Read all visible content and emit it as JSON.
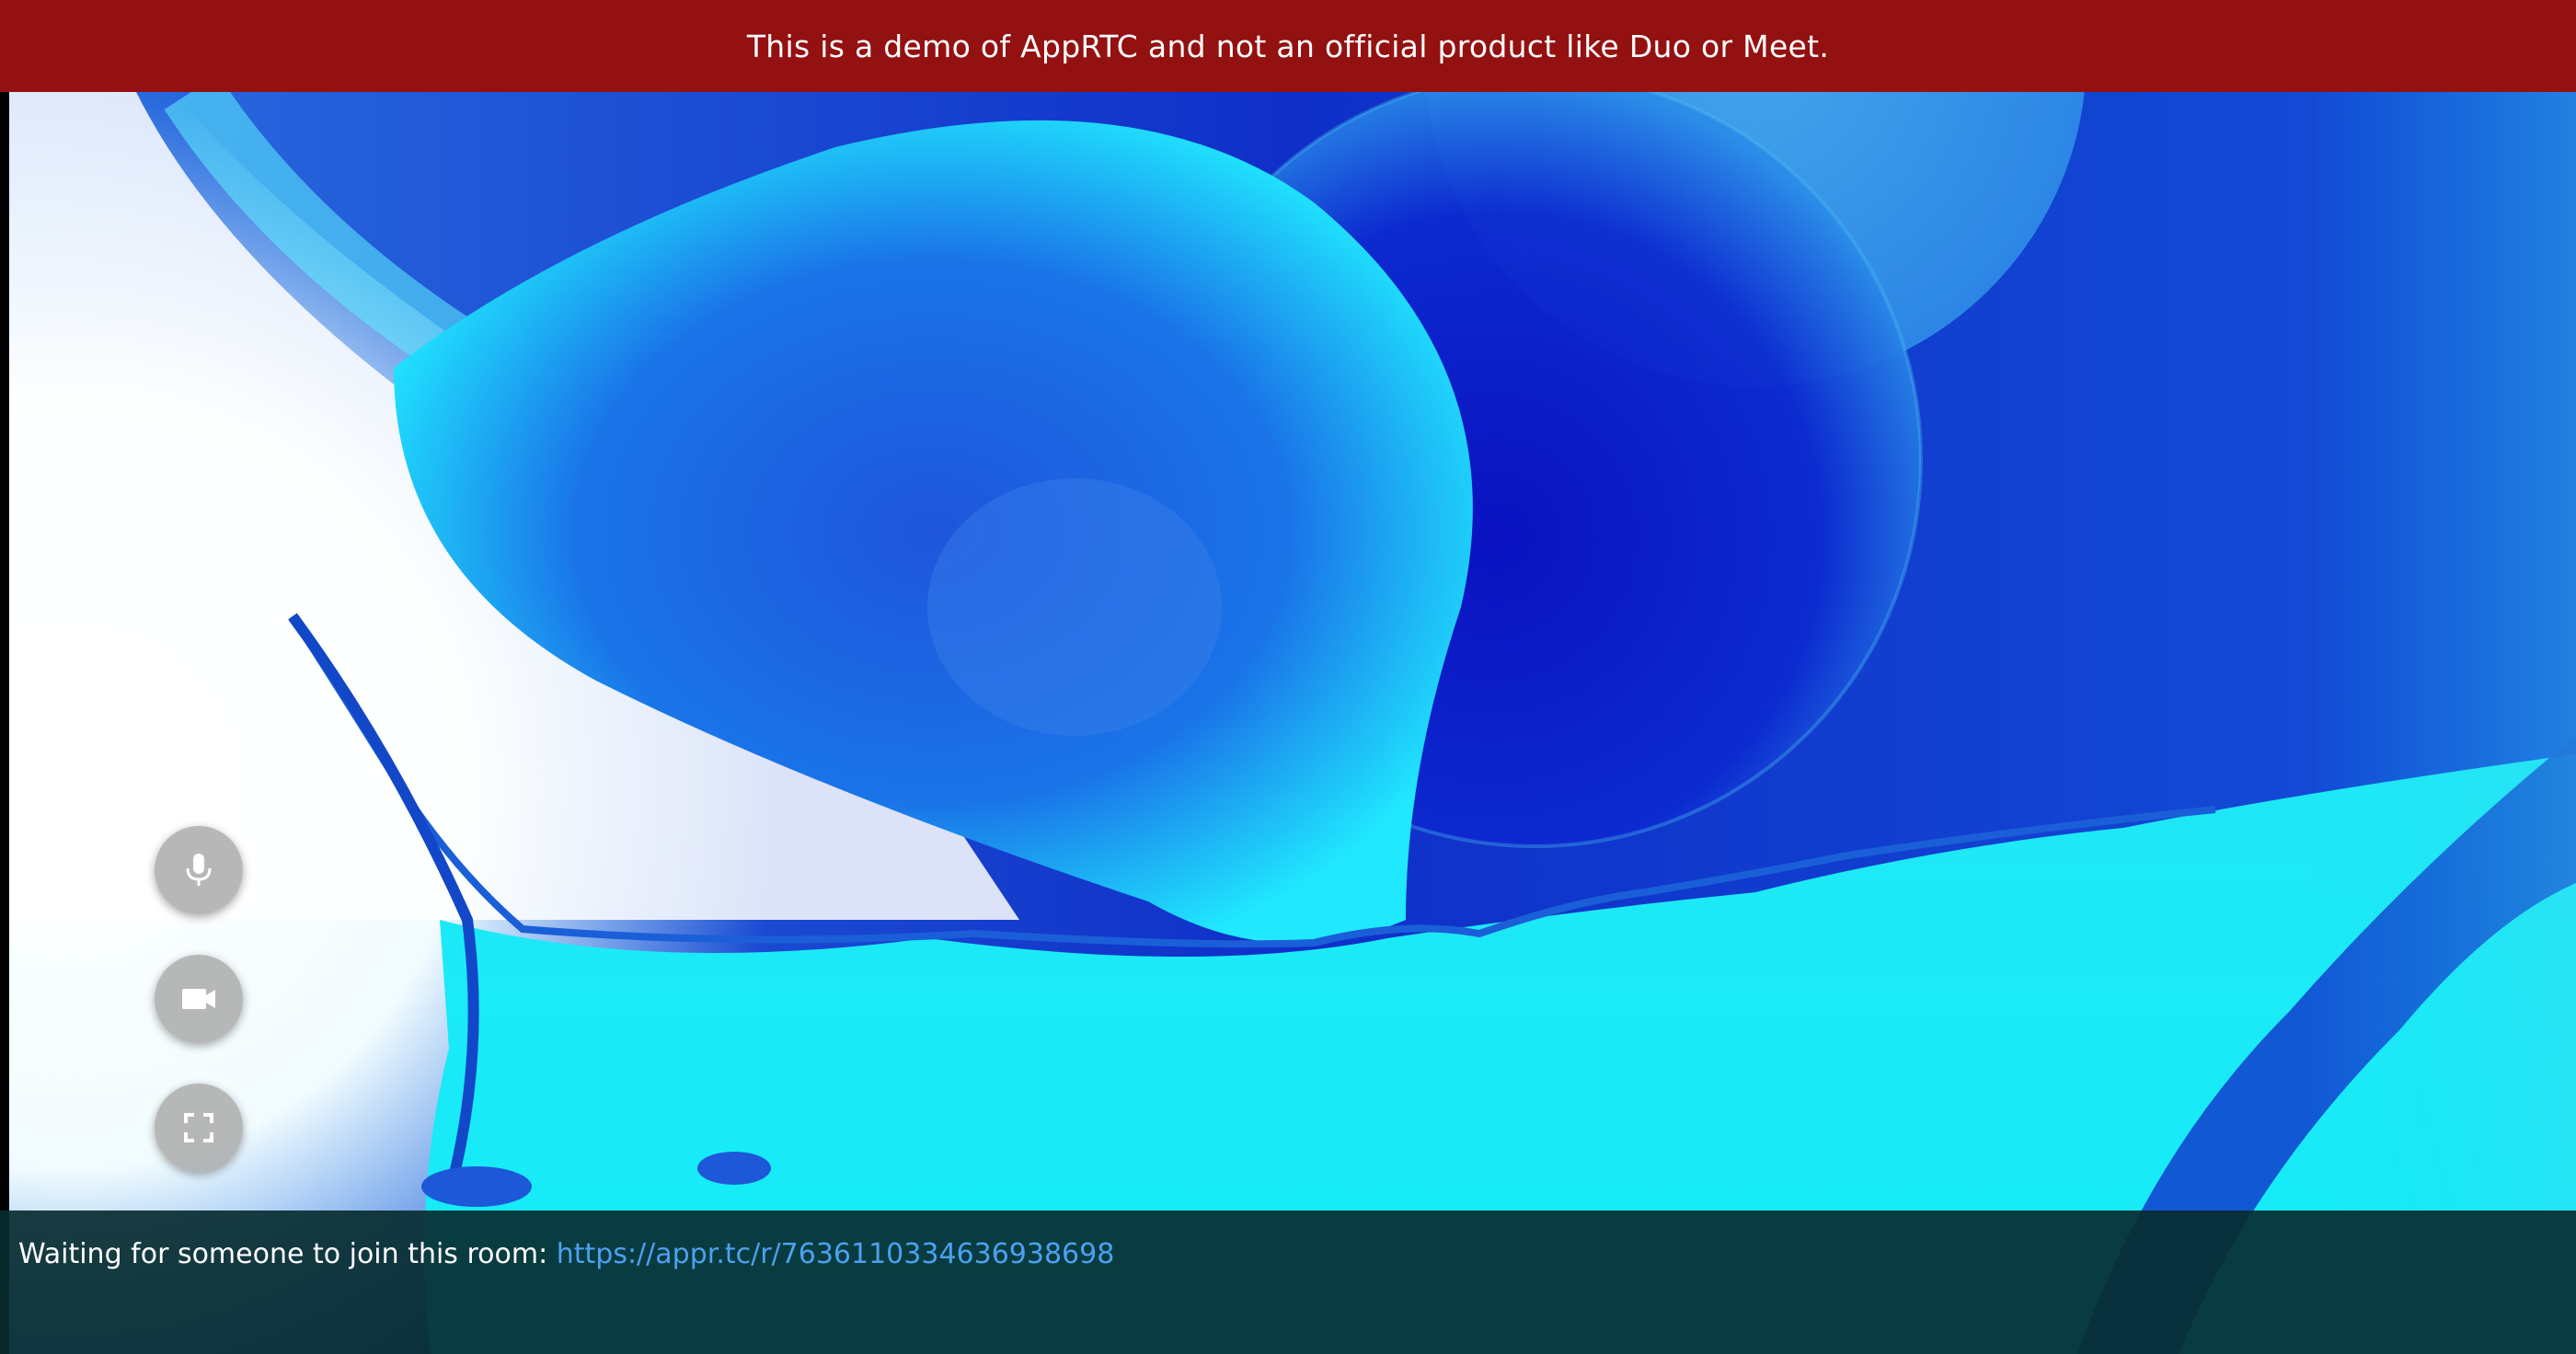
{
  "banner": {
    "text": "This is a demo of AppRTC and not an official product like Duo or Meet."
  },
  "controls": {
    "mute_icon": "microphone-icon",
    "video_icon": "video-camera-icon",
    "fullscreen_icon": "fullscreen-icon"
  },
  "status": {
    "message": "Waiting for someone to join this room:",
    "room_link": "https://appr.tc/r/7636110334636938698"
  },
  "colors": {
    "banner_bg": "#941111",
    "link": "#4ea0f0",
    "status_bg": "#082c30"
  }
}
